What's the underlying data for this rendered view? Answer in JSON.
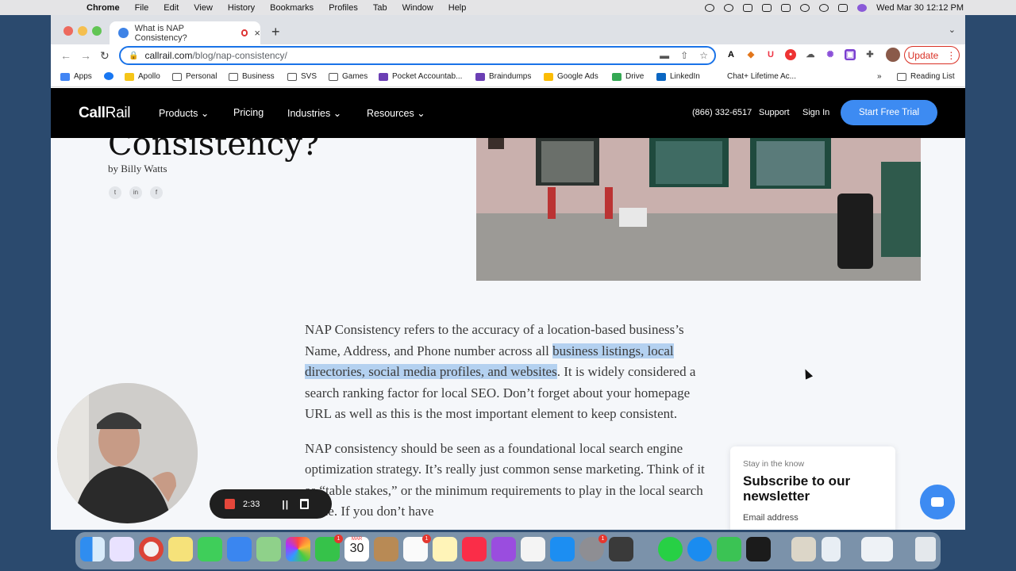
{
  "menubar": {
    "app": "Chrome",
    "items": [
      "File",
      "Edit",
      "View",
      "History",
      "Bookmarks",
      "Profiles",
      "Tab",
      "Window",
      "Help"
    ],
    "datetime": "Wed Mar 30  12:12 PM"
  },
  "browser": {
    "tab_title": "What is NAP Consistency?",
    "url_host": "callrail.com",
    "url_path": "/blog/nap-consistency/",
    "update_label": "Update",
    "bookmarks": [
      "Apps",
      "Apollo",
      "Personal",
      "Business",
      "SVS",
      "Games",
      "Pocket Accountab...",
      "Braindumps",
      "Google Ads",
      "Drive",
      "LinkedIn",
      "Chat+ Lifetime Ac..."
    ],
    "reading_list": "Reading List",
    "overflow": "»"
  },
  "site": {
    "logo_bold": "Call",
    "logo_thin": "Rail",
    "nav": {
      "products": "Products",
      "pricing": "Pricing",
      "industries": "Industries",
      "resources": "Resources",
      "phone": "(866) 332-6517",
      "support": "Support",
      "sign_in": "Sign In",
      "cta": "Start Free Trial"
    },
    "heading_fragment": "Consistency?",
    "byline_prefix": "by ",
    "author": "Billy Watts",
    "social": [
      "twitter-icon",
      "linkedin-icon",
      "facebook-icon"
    ],
    "paragraph1": {
      "before": "NAP Consistency refers to the accuracy of a location-based business’s Name, Address, and Phone number across all ",
      "highlight": "business listings, local directories, social media profiles, and websites",
      "after": ". It is widely considered a search ranking factor for local SEO. Don’t forget about your homepage URL as well as this is the most important element to keep consistent."
    },
    "paragraph2": "NAP consistency should be seen as a foundational local search engine optimization strategy. It’s really just common sense marketing. Think of it as “table stakes,” or the minimum requirements to play in the local search game. If you don’t have",
    "newsletter": {
      "eyebrow": "Stay in the know",
      "title": "Subscribe to our newsletter",
      "email_label": "Email address"
    }
  },
  "recorder": {
    "time": "2:33"
  },
  "dock": {
    "calendar_month": "MAR",
    "calendar_day": "30",
    "badge": "1"
  }
}
